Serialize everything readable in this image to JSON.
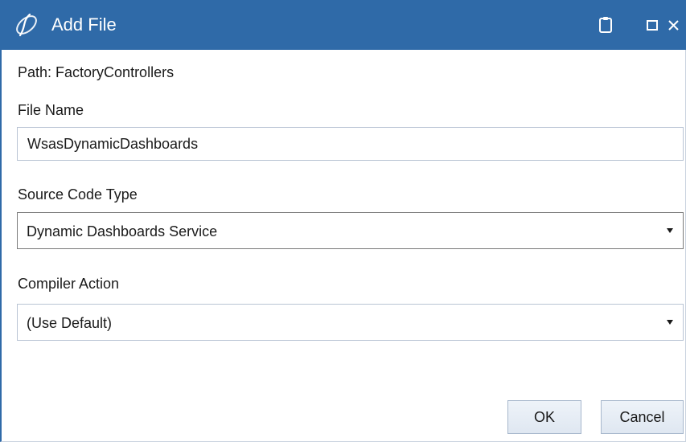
{
  "window": {
    "title": "Add File",
    "logo_icon": "swirl-logo-icon",
    "controls": [
      "clipboard-icon",
      "maximize-icon",
      "close-icon"
    ]
  },
  "form": {
    "path_label": "Path:  FactoryControllers",
    "file_name_label": "File Name",
    "file_name_value": "WsasDynamicDashboards",
    "source_code_type_label": "Source Code Type",
    "source_code_type_value": "Dynamic Dashboards Service",
    "compiler_action_label": "Compiler Action",
    "compiler_action_value": "(Use Default)"
  },
  "buttons": {
    "ok": "OK",
    "cancel": "Cancel"
  },
  "colors": {
    "titlebar": "#2f6aa8",
    "titlebar_text": "#ffffff",
    "button_bg": "#e6edf5",
    "border": "#b9c4d4"
  }
}
